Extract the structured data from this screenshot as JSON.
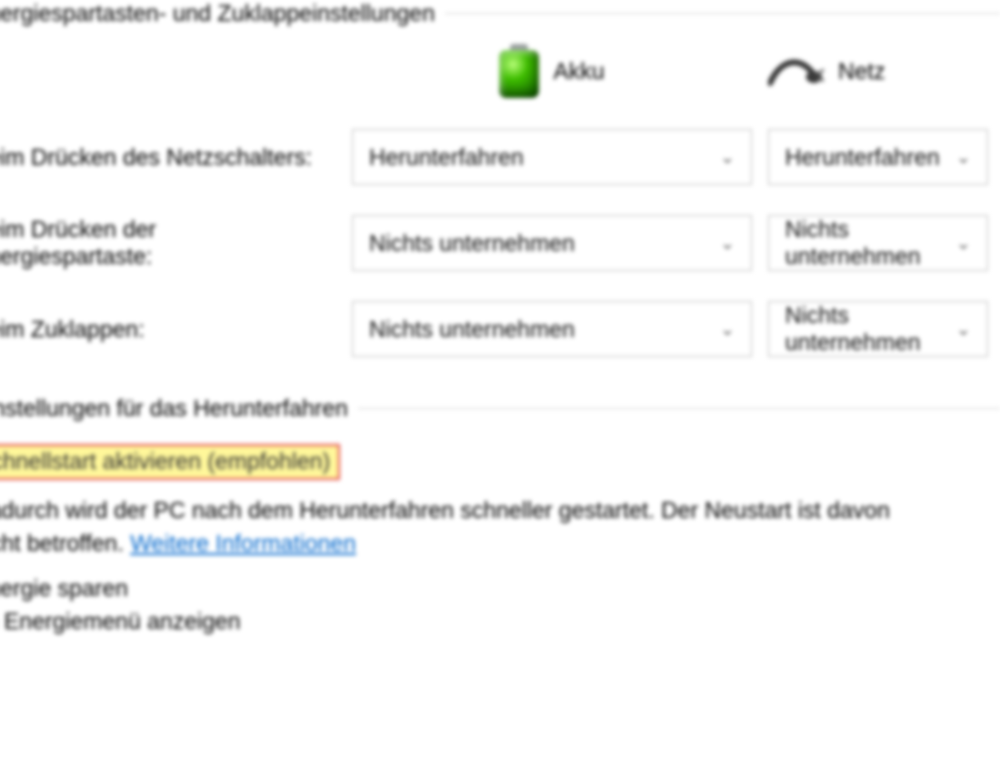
{
  "section1": {
    "title": "Energiespartasten- und Zuklappeinstellungen",
    "col_battery_label": "Akku",
    "col_plugged_label": "Netz",
    "rows": [
      {
        "label": "Beim Drücken des Netzschalters:",
        "battery": "Herunterfahren",
        "plugged": "Herunterfahren"
      },
      {
        "label": "Beim Drücken der Energiespartaste:",
        "battery": "Nichts unternehmen",
        "plugged": "Nichts unternehmen"
      },
      {
        "label": "Beim Zuklappen:",
        "battery": "Nichts unternehmen",
        "plugged": "Nichts unternehmen"
      }
    ]
  },
  "section2": {
    "title": "Einstellungen für das Herunterfahren",
    "fast_start_label": "Schnellstart aktivieren (empfohlen)",
    "desc_line1": "Dadurch wird der PC nach dem Herunterfahren schneller gestartet. Der Neustart ist davon",
    "desc_line2_prefix": "nicht betroffen. ",
    "more_info": "Weitere Informationen",
    "hibernate_label": "Energie sparen",
    "hibernate_desc": "Im Energiemenü anzeigen"
  }
}
